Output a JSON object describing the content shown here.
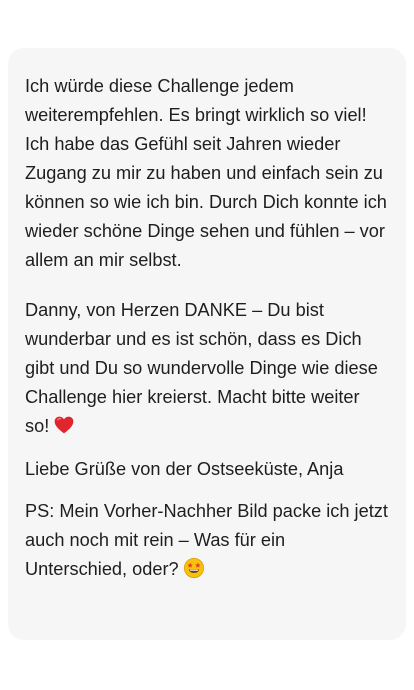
{
  "message": {
    "paragraph_1": "Ich würde diese Challenge jedem weiterempfehlen. Es bringt wirklich so viel! Ich habe das Gefühl seit Jahren wieder Zugang zu mir zu haben und einfach sein zu können so wie ich bin. Durch Dich konnte ich wieder schöne Dinge sehen und fühlen – vor allem an mir selbst.",
    "paragraph_2": "Danny, von Herzen DANKE – Du bist wunderbar und es ist schön, dass es Dich gibt und Du so wundervolle Dinge wie diese Challenge hier kreierst. Macht bitte weiter so!",
    "paragraph_2_emoji": "red-heart-icon",
    "paragraph_3": "Liebe Grüße von der Ostseeküste, Anja",
    "paragraph_4": "PS: Mein Vorher-Nachher Bild packe ich jetzt auch noch mit rein – Was für ein Unterschied, oder?",
    "paragraph_4_emoji": "star-struck-face-icon"
  },
  "colors": {
    "bubble_background": "#f6f6f6",
    "text": "#1e1e1e",
    "heart": "#e0252f",
    "emoji_face": "#f9c20a"
  }
}
